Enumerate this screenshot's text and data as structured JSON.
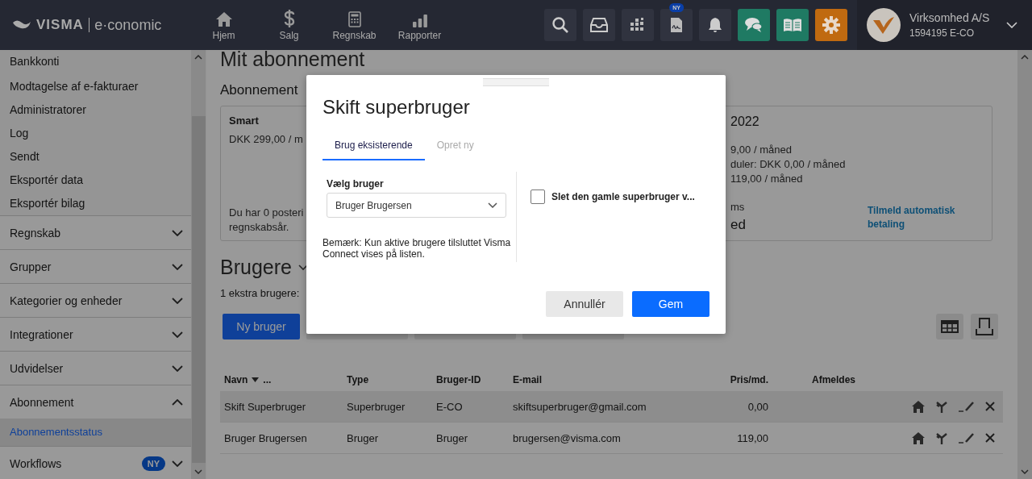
{
  "header": {
    "logo": {
      "brand": "VISMA",
      "product": "e·conomic"
    },
    "nav": [
      {
        "label": "Hjem",
        "kind": "home"
      },
      {
        "label": "Salg",
        "kind": "dollar"
      },
      {
        "label": "Regnskab",
        "kind": "calculator"
      },
      {
        "label": "Rapporter",
        "kind": "bars"
      }
    ],
    "tools": [
      {
        "kind": "search"
      },
      {
        "kind": "inbox"
      },
      {
        "kind": "apps"
      },
      {
        "kind": "document",
        "badge": "NY"
      },
      {
        "kind": "bell"
      },
      {
        "kind": "chat"
      },
      {
        "kind": "book"
      },
      {
        "kind": "gear"
      }
    ],
    "account": {
      "name": "Virksomhed A/S",
      "id": "1594195 E-CO"
    }
  },
  "sidebar": {
    "links": [
      "Bankkonti",
      "Modtagelse af e-fakturaer",
      "Administratorer",
      "Log",
      "Sendt",
      "Eksportér data",
      "Eksportér bilag"
    ],
    "groups": [
      {
        "label": "Regnskab",
        "expanded": false
      },
      {
        "label": "Grupper",
        "expanded": false
      },
      {
        "label": "Kategorier og enheder",
        "expanded": false
      },
      {
        "label": "Integrationer",
        "expanded": false
      },
      {
        "label": "Udvidelser",
        "expanded": false
      },
      {
        "label": "Abonnement",
        "expanded": true,
        "children": [
          {
            "label": "Abonnementsstatus",
            "selected": true
          }
        ]
      },
      {
        "label": "Workflows",
        "expanded": false,
        "badge": "NY"
      }
    ]
  },
  "page": {
    "title": "Mit abonnement",
    "section": "Abonnement",
    "card": {
      "plan": "Smart",
      "price": "DKK 299,00 / m",
      "note": [
        "Du har 0 posteri",
        "regnskabsår."
      ],
      "heading": "2022",
      "lines": [
        "9,00 / måned",
        "duler: DKK 0,00 / måned",
        "119,00 / måned"
      ],
      "label": "ms",
      "value": "ed",
      "link": "Tilmeld automatisk betaling"
    },
    "users_title": "Brugere",
    "summary": "1 ekstra brugere:",
    "buttons": [
      {
        "label": "Ny bruger",
        "kind": "primary"
      },
      {
        "kind": "secondary"
      },
      {
        "kind": "secondary"
      },
      {
        "kind": "secondary"
      }
    ],
    "columns": [
      {
        "label": "Navn",
        "sorted": true,
        "more": "..."
      },
      {
        "label": "Type",
        "sorted": false
      },
      {
        "label": "Bruger-ID",
        "sorted": false
      },
      {
        "label": "E-mail",
        "sorted": false
      },
      {
        "label": "Pris/md.",
        "sorted": false
      },
      {
        "label": "Afmeldes",
        "sorted": false
      }
    ],
    "rows": [
      {
        "selected": true,
        "cells": [
          "Skift Superbruger",
          "Superbruger",
          "E-CO",
          "skiftsuperbruger@gmail.com",
          "0,00",
          ""
        ]
      },
      {
        "selected": false,
        "cells": [
          "Bruger Brugersen",
          "Bruger",
          "Bruger",
          "brugersen@visma.com",
          "119,00",
          ""
        ]
      }
    ]
  },
  "modal": {
    "title": "Skift superbruger",
    "tabs": [
      {
        "label": "Brug eksisterende",
        "selected": true
      },
      {
        "label": "Opret ny",
        "selected": false
      }
    ],
    "field_label": "Vælg bruger",
    "select_value": "Bruger Brugersen",
    "note": "Bemærk: Kun aktive brugere tilsluttet Visma Connect vises på listen.",
    "checkbox": {
      "label": "Slet den gamle superbruger v...",
      "checked": false
    },
    "buttons": [
      {
        "label": "Annullér",
        "kind": "secondary"
      },
      {
        "label": "Gem",
        "kind": "primary"
      }
    ]
  }
}
